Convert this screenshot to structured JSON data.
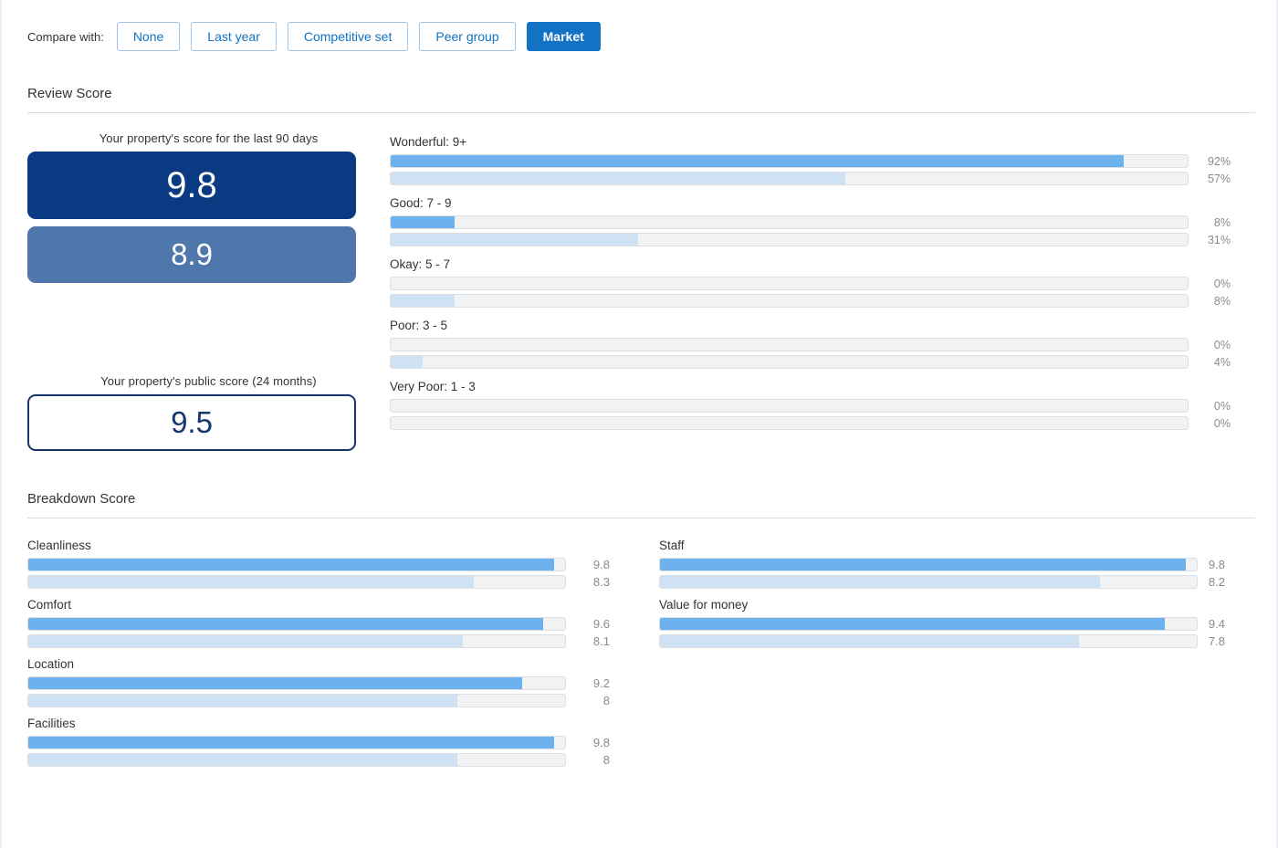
{
  "compare": {
    "label": "Compare with:",
    "options": [
      {
        "label": "None",
        "active": false
      },
      {
        "label": "Last year",
        "active": false
      },
      {
        "label": "Competitive set",
        "active": false
      },
      {
        "label": "Peer group",
        "active": false
      },
      {
        "label": "Market",
        "active": true
      }
    ]
  },
  "colors": {
    "accent": "#1273c4",
    "primary_score_bg": "#0a3b82",
    "compare_score_bg": "#5077ab",
    "public_score_border": "#17366b",
    "bar_you": "#6cb2ee",
    "bar_market": "#cfe2f3",
    "track": "#f1f2f4"
  },
  "review_section": {
    "title": "Review Score",
    "score_caption": "Your property's score for the last 90 days",
    "score_value": "9.8",
    "compare_value": "8.9",
    "public_caption": "Your property's public score (24 months)",
    "public_value": "9.5"
  },
  "breakdown_section": {
    "title": "Breakdown Score"
  },
  "chart_data": [
    {
      "type": "bar",
      "title": "Review Score",
      "orientation": "horizontal",
      "categories": [
        "Wonderful: 9+",
        "Good: 7 - 9",
        "Okay: 5 - 7",
        "Poor: 3 - 5",
        "Very Poor: 1 - 3"
      ],
      "series": [
        {
          "name": "Your property",
          "values": [
            92,
            8,
            0,
            0,
            0
          ],
          "labels": [
            "92%",
            "8%",
            "0%",
            "0%",
            "0%"
          ],
          "color": "#6cb2ee"
        },
        {
          "name": "Market",
          "values": [
            57,
            31,
            8,
            4,
            0
          ],
          "labels": [
            "57%",
            "31%",
            "8%",
            "4%",
            "0%"
          ],
          "color": "#cfe2f3"
        }
      ],
      "xlabel": "",
      "ylabel": "",
      "xlim": [
        0,
        100
      ],
      "unit": "%",
      "grid": false,
      "legend": false
    },
    {
      "type": "bar",
      "title": "Breakdown Score",
      "orientation": "horizontal",
      "categories": [
        "Cleanliness",
        "Comfort",
        "Location",
        "Facilities",
        "Staff",
        "Value for money"
      ],
      "series": [
        {
          "name": "Your property",
          "values": [
            9.8,
            9.6,
            9.2,
            9.8,
            9.8,
            9.4
          ],
          "labels": [
            "9.8",
            "9.6",
            "9.2",
            "9.8",
            "9.8",
            "9.4"
          ],
          "color": "#6cb2ee"
        },
        {
          "name": "Market",
          "values": [
            8.3,
            8.1,
            8,
            8,
            8.2,
            7.8
          ],
          "labels": [
            "8.3",
            "8.1",
            "8",
            "8",
            "8.2",
            "7.8"
          ],
          "color": "#cfe2f3"
        }
      ],
      "xlabel": "",
      "ylabel": "",
      "xlim": [
        0,
        10
      ],
      "grid": false,
      "legend": false
    }
  ],
  "distribution": [
    {
      "label": "Wonderful: 9+",
      "you_pct": 92,
      "you_label": "92%",
      "mkt_pct": 57,
      "mkt_label": "57%"
    },
    {
      "label": "Good: 7 - 9",
      "you_pct": 8,
      "you_label": "8%",
      "mkt_pct": 31,
      "mkt_label": "31%"
    },
    {
      "label": "Okay: 5 - 7",
      "you_pct": 0,
      "you_label": "0%",
      "mkt_pct": 8,
      "mkt_label": "8%"
    },
    {
      "label": "Poor: 3 - 5",
      "you_pct": 0,
      "you_label": "0%",
      "mkt_pct": 4,
      "mkt_label": "4%"
    },
    {
      "label": "Very Poor: 1 - 3",
      "you_pct": 0,
      "you_label": "0%",
      "mkt_pct": 0,
      "mkt_label": "0%"
    }
  ],
  "breakdown_left": [
    {
      "label": "Cleanliness",
      "you": 9.8,
      "you_label": "9.8",
      "mkt": 8.3,
      "mkt_label": "8.3"
    },
    {
      "label": "Comfort",
      "you": 9.6,
      "you_label": "9.6",
      "mkt": 8.1,
      "mkt_label": "8.1"
    },
    {
      "label": "Location",
      "you": 9.2,
      "you_label": "9.2",
      "mkt": 8.0,
      "mkt_label": "8"
    },
    {
      "label": "Facilities",
      "you": 9.8,
      "you_label": "9.8",
      "mkt": 8.0,
      "mkt_label": "8"
    }
  ],
  "breakdown_right": [
    {
      "label": "Staff",
      "you": 9.8,
      "you_label": "9.8",
      "mkt": 8.2,
      "mkt_label": "8.2"
    },
    {
      "label": "Value for money",
      "you": 9.4,
      "you_label": "9.4",
      "mkt": 7.8,
      "mkt_label": "7.8"
    }
  ]
}
